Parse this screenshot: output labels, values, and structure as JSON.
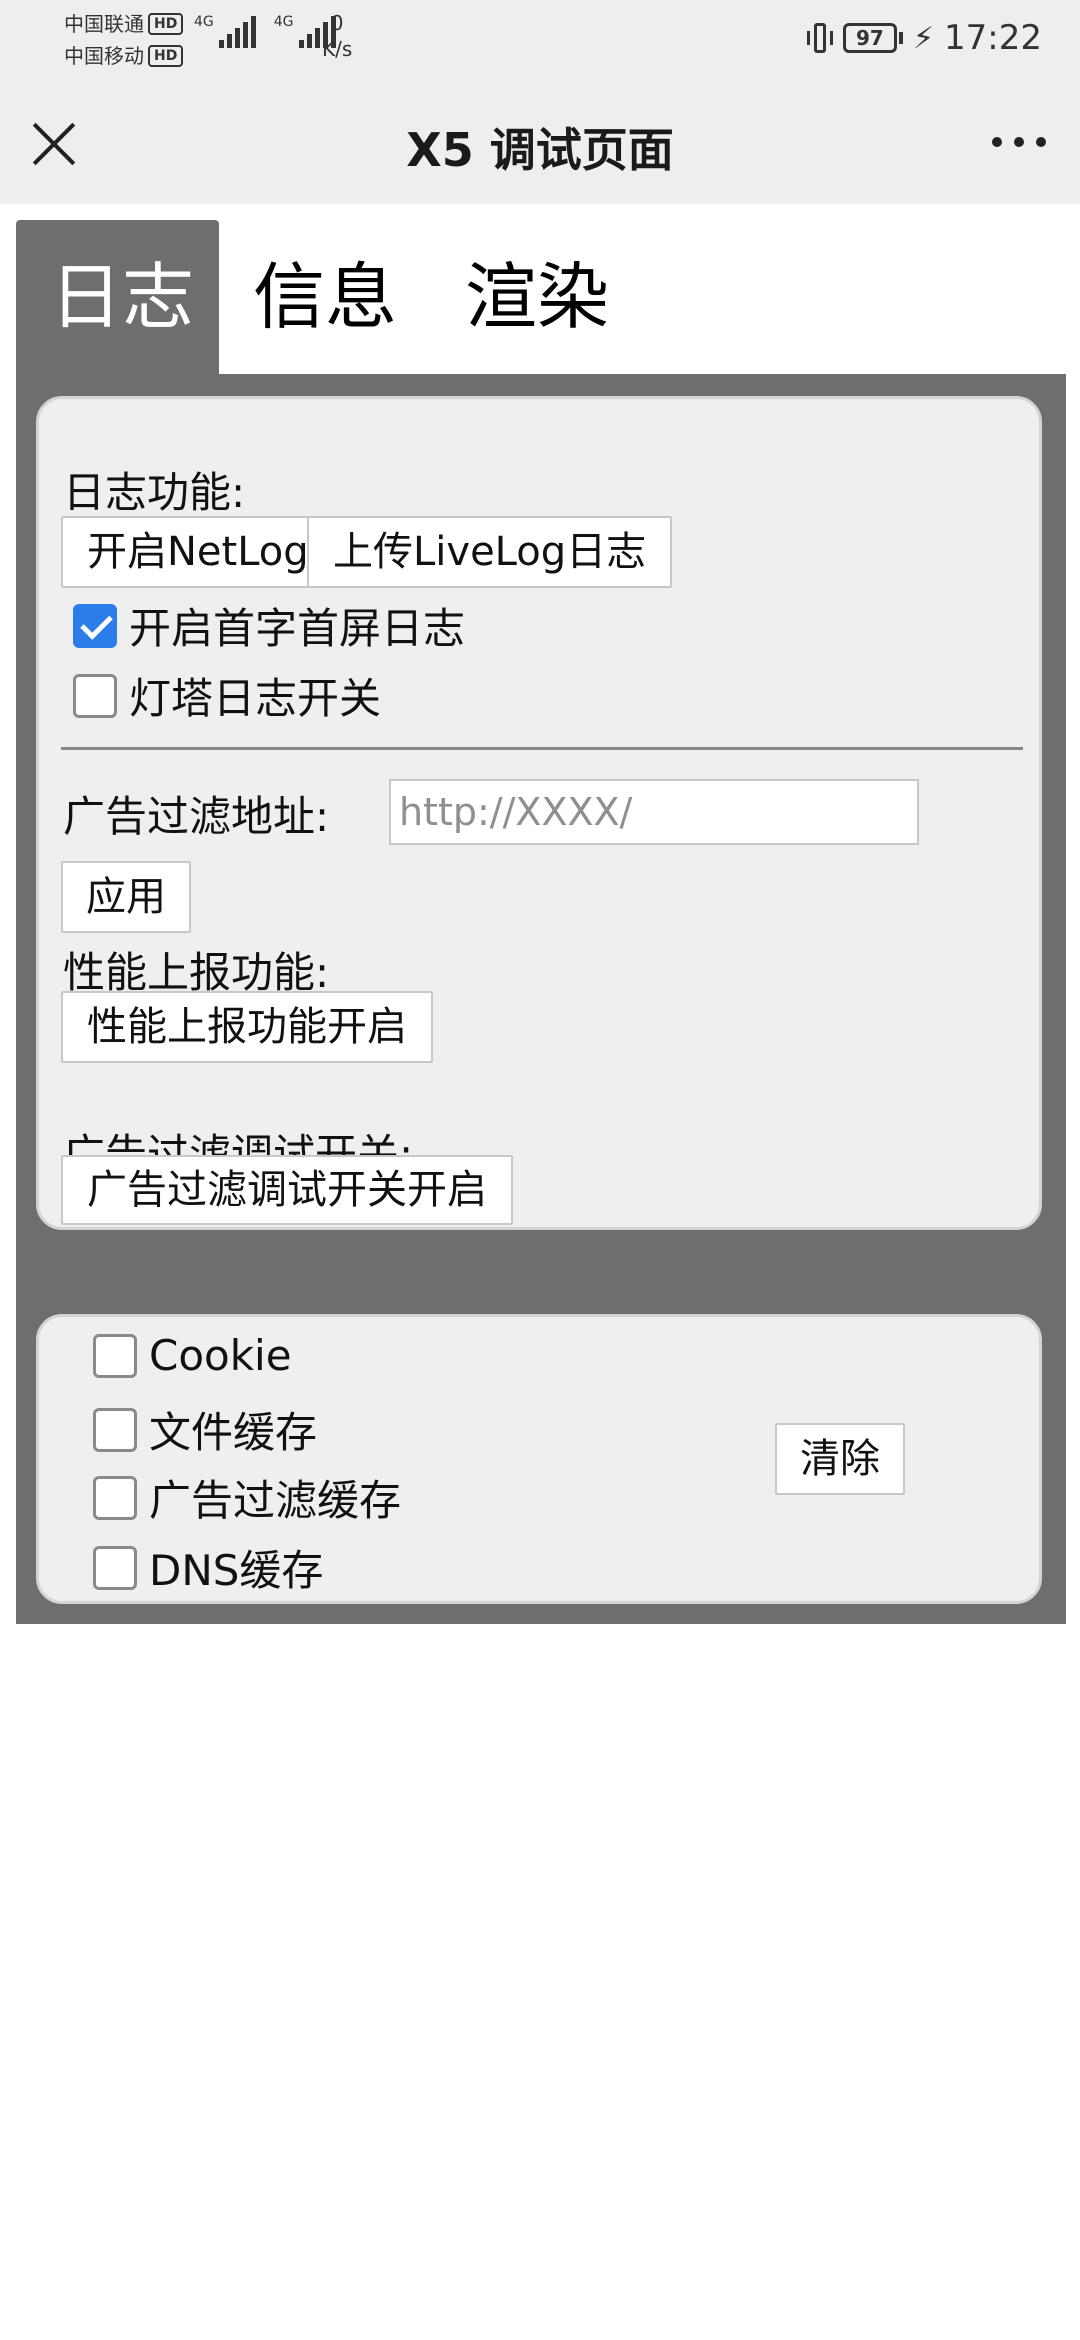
{
  "status_bar": {
    "carrier1": "中国联通",
    "carrier2": "中国移动",
    "hd_badge": "HD",
    "network1": "4G",
    "network2": "4G",
    "speed_value": "0",
    "speed_unit": "K/s",
    "battery": "97",
    "time": "17:22",
    "icons": [
      "vibrate-icon",
      "battery-icon",
      "charging-icon"
    ]
  },
  "title_bar": {
    "title": "X5 调试页面",
    "icons": [
      "close-icon",
      "more-icon"
    ]
  },
  "tabs": [
    {
      "label": "日志",
      "active": true
    },
    {
      "label": "信息",
      "active": false
    },
    {
      "label": "渲染",
      "active": false
    }
  ],
  "log_section": {
    "log_label": "日志功能:",
    "netlog_button": "开启NetLog记录",
    "livelog_button": "上传LiveLog日志",
    "first_screen_log": {
      "label": "开启首字首屏日志",
      "checked": true
    },
    "beacon_log": {
      "label": "灯塔日志开关",
      "checked": false
    },
    "ad_filter_label": "广告过滤地址:",
    "ad_filter_placeholder": "http://XXXX/",
    "ad_filter_value": "",
    "apply_button": "应用",
    "perf_label": "性能上报功能:",
    "perf_button": "性能上报功能开启",
    "ad_debug_label": "广告过滤调试开关:",
    "ad_debug_button": "广告过滤调试开关开启"
  },
  "clear_section": {
    "options": [
      {
        "label": "Cookie",
        "checked": false
      },
      {
        "label": "文件缓存",
        "checked": false
      },
      {
        "label": "广告过滤缓存",
        "checked": false
      },
      {
        "label": "DNS缓存",
        "checked": false
      }
    ],
    "clear_button": "清除"
  },
  "colors": {
    "panel_bg": "#6e6e6e",
    "card_bg": "#efefef",
    "checkbox_checked": "#2b7de9",
    "header_bg": "#eeeeee"
  }
}
